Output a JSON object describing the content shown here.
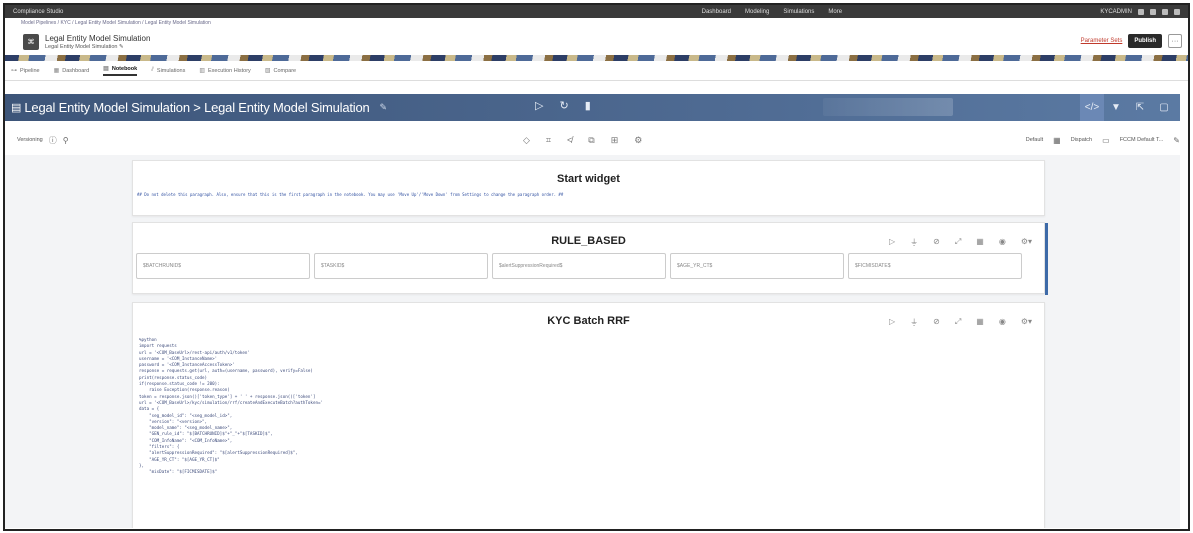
{
  "topbar": {
    "app": "Compliance Studio",
    "menus": [
      "Dashboard",
      "Modeling",
      "Simulations",
      "More"
    ],
    "user": "KYCADMIN"
  },
  "breadcrumb": "Model Pipelines / KYC / Legal Entity Model Simulation / Legal Entity Model Simulation",
  "header": {
    "title": "Legal Entity Model Simulation",
    "subtitle": "Legal Entity Model Simulation",
    "param_link": "Parameter Sets",
    "publish_label": "Publish",
    "more_label": "···"
  },
  "tabs": [
    {
      "label": "Pipeline",
      "icon": "pipeline-icon"
    },
    {
      "label": "Dashboard",
      "icon": "dashboard-icon"
    },
    {
      "label": "Notebook",
      "icon": "notebook-icon",
      "active": true
    },
    {
      "label": "Simulations",
      "icon": "simulations-icon"
    },
    {
      "label": "Execution History",
      "icon": "history-icon"
    },
    {
      "label": "Compare",
      "icon": "compare-icon"
    }
  ],
  "notebook": {
    "title": "Legal Entity Model Simulation > Legal Entity Model Simulation"
  },
  "toolbar": {
    "mode_label": "Versioning",
    "default_label": "Default",
    "dispatch_label": "Dispatch",
    "interpreter_label": "FCCM Default T..."
  },
  "paragraphs": {
    "start_widget": {
      "title": "Start widget",
      "text": "## Do not delete this paragraph. Also, ensure that this is the first paragraph in the notebook. You may use 'Move Up'/'Move  Down' from Settings to change the paragraph order. ##"
    },
    "rule_based": {
      "title": "RULE_BASED",
      "inputs": [
        "$BATCHRUNID$",
        "$TASKID$",
        "$alertSuppressionRequired$",
        "$AGE_YR_CT$",
        "$FICMISDATE$"
      ]
    },
    "kyc_batch": {
      "title": "KYC Batch RRF",
      "code": [
        "%python",
        "import requests",
        "url = '<COM_BaseUrl>/rest-api/auth/v1/token'",
        "username = '<COM_InstanceName>'",
        "password = '<COM_InstanceAccessToken>'",
        "response = requests.get(url, auth=(username, password), verify=False)",
        "print(response.status_code)",
        "if(response.status_code != 200):",
        "    raise Exception(response.reason)",
        "token = response.json()['token_type'] + ' ' + response.json()['token']",
        "url = '<COM_BaseUrl>/kyc/simulation/rrf/createAndExecuteBatch?authToken='",
        "data = {",
        "    \"seg_model_id\": \"<seg_model_id>\",",
        "    \"version\": \"<version>\",",
        "    \"model_name\": \"<seg_model_name>\",",
        "    \"GEN_rule_id\": \"$[BATCHRUNID]$\"+\"_\"+\"$[TASKID]$\",",
        "    \"COM_InfoName\": \"<COM_InfoName>\",",
        "    \"filters\": {",
        "    \"alertSuppressionRequired\": \"$[alertSuppressionRequired]$\",",
        "    \"AGE_YR_CT\": \"$[AGE_YR_CT]$\"",
        "},",
        "    \"misDate\": \"$[FICMISDATE]$\""
      ]
    }
  }
}
